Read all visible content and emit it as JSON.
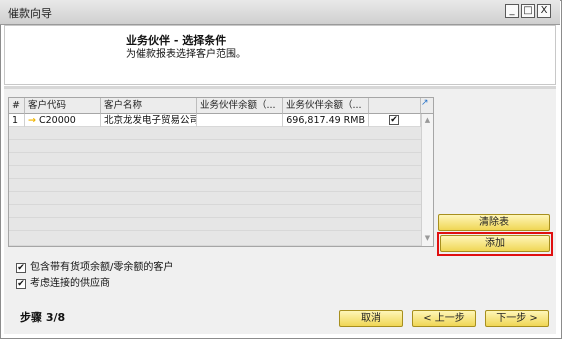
{
  "window": {
    "title": "催款向导",
    "controls": [
      "_",
      "□",
      "X"
    ]
  },
  "header": {
    "title": "业务伙伴 - 选择条件",
    "subtitle": "为催款报表选择客户范围。"
  },
  "table": {
    "columns": [
      "#",
      "客户代码",
      "客户名称",
      "业务伙伴余额（...",
      "业务伙伴余额（..."
    ],
    "rows": [
      {
        "num": "1",
        "code": "C20000",
        "name": "北京龙发电子贸易公司",
        "bp_balance_local": "",
        "bp_balance_rmb": "696,817.49 RMB",
        "checked": "✔"
      }
    ]
  },
  "buttons": {
    "clear_table": "清除表",
    "add": "添加",
    "cancel": "取消",
    "back": "< 上一步",
    "next": "下一步 >"
  },
  "options": [
    {
      "label": "包含带有货项余额/零余额的客户",
      "checked": "✔"
    },
    {
      "label": "考虑连接的供应商",
      "checked": "✔"
    }
  ],
  "step_text": "步骤 3/8",
  "icons": {
    "code_link": "→",
    "expand": "↗",
    "scroll_up": "▲",
    "scroll_down": "▼"
  },
  "colors": {
    "button_top": "#fff6b8",
    "button_bottom": "#f0d655",
    "highlight": "#e01010",
    "link_arrow": "#f0b400"
  }
}
